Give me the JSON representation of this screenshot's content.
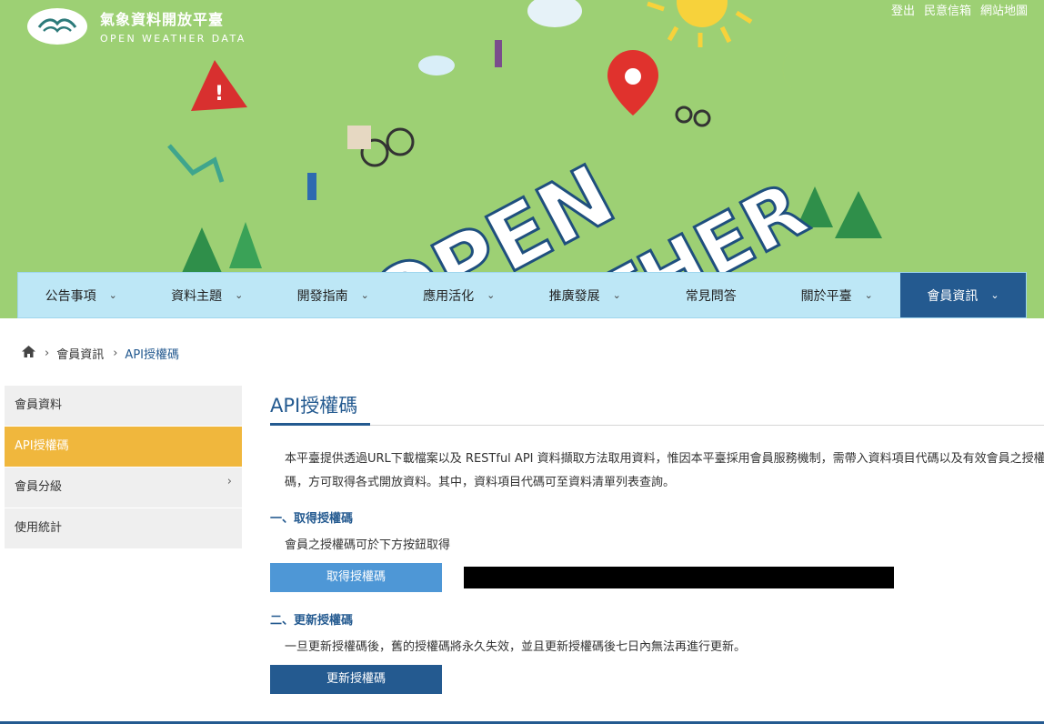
{
  "site": {
    "title": "氣象資料開放平臺",
    "subtitle": "OPEN WEATHER DATA",
    "logo_icon": "cloud-swirl-icon"
  },
  "top_links": [
    {
      "label": "登出"
    },
    {
      "label": "民意信箱"
    },
    {
      "label": "網站地圖"
    }
  ],
  "banner": {
    "text": "OPEN WEATHER",
    "colors": {
      "background": "#9dd074"
    }
  },
  "nav": [
    {
      "label": "公告事項",
      "icon": "chevron-down-icon"
    },
    {
      "label": "資料主題",
      "icon": "chevron-down-icon"
    },
    {
      "label": "開發指南",
      "icon": "chevron-down-icon"
    },
    {
      "label": "應用活化",
      "icon": "chevron-down-icon"
    },
    {
      "label": "推廣發展",
      "icon": "chevron-down-icon"
    },
    {
      "label": "常見問答"
    },
    {
      "label": "關於平臺",
      "icon": "chevron-down-icon"
    },
    {
      "label": "會員資訊",
      "icon": "chevron-down-icon",
      "active": true
    }
  ],
  "breadcrumb": {
    "home_icon": "home-icon",
    "items": [
      "會員資訊",
      "API授權碼"
    ]
  },
  "sidebar": [
    {
      "label": "會員資料"
    },
    {
      "label": "API授權碼",
      "active": true
    },
    {
      "label": "會員分級",
      "icon": "chevron-right-icon"
    },
    {
      "label": "使用統計"
    }
  ],
  "main": {
    "title": "API授權碼",
    "intro": "本平臺提供透過URL下載檔案以及 RESTful API 資料擷取方法取用資料，惟因本平臺採用會員服務機制，需帶入資料項目代碼以及有效會員之授權碼，方可取得各式開放資料。其中，資料項目代碼可至資料清單列表查詢。",
    "section1": {
      "heading": "一、取得授權碼",
      "text": "會員之授權碼可於下方按鈕取得",
      "button": "取得授權碼"
    },
    "section2": {
      "heading": "二、更新授權碼",
      "text": "一旦更新授權碼後，舊的授權碼將永久失效，並且更新授權碼後七日內無法再進行更新。",
      "button": "更新授權碼"
    }
  },
  "colors": {
    "accent": "#245a90",
    "sidebar_active": "#f0b73d",
    "nav_bg": "#bde7f6",
    "button_light": "#4e97d6"
  }
}
